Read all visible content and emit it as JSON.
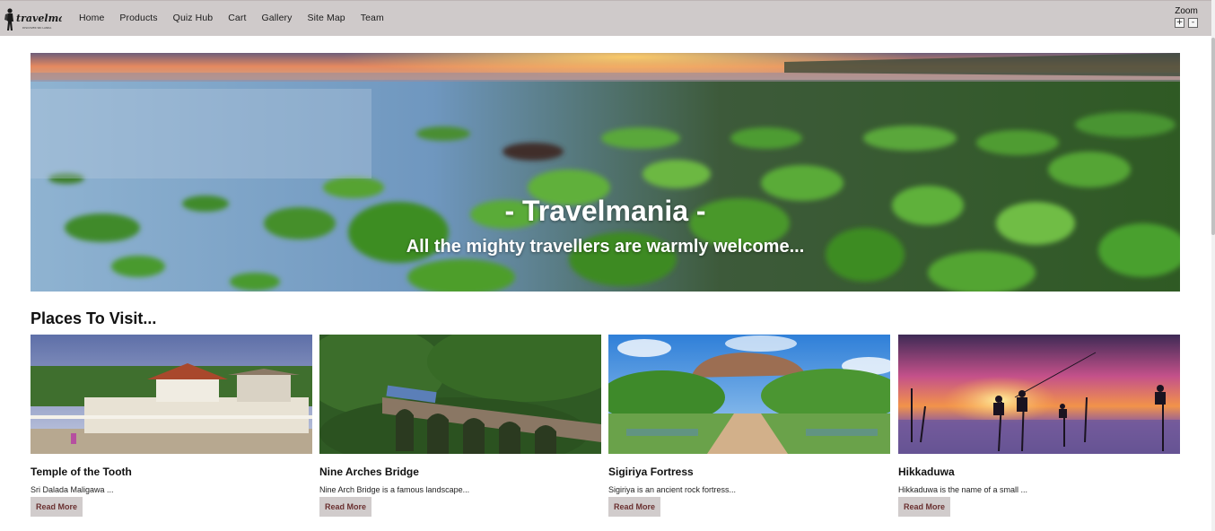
{
  "brand": {
    "logo_text": "Travelmania",
    "logo_tagline": "DISCOVER SRI LANKA"
  },
  "nav": {
    "links": [
      "Home",
      "Products",
      "Quiz Hub",
      "Cart",
      "Gallery",
      "Site Map",
      "Team"
    ]
  },
  "zoom": {
    "label": "Zoom",
    "plus": "+",
    "minus": "-"
  },
  "hero": {
    "title": "- Travelmania -",
    "subtitle": "All the mighty travellers are warmly welcome..."
  },
  "places": {
    "heading": "Places To Visit...",
    "read_more_label": "Read More",
    "items": [
      {
        "title": "Temple of the Tooth",
        "desc": "Sri Dalada Maligawa ..."
      },
      {
        "title": "Nine Arches Bridge",
        "desc": "Nine Arch Bridge is a famous landscape..."
      },
      {
        "title": "Sigiriya Fortress",
        "desc": "Sigiriya is an ancient rock fortress..."
      },
      {
        "title": "Hikkaduwa",
        "desc": "Hikkaduwa is the name of a small ..."
      }
    ]
  },
  "colors": {
    "navbar_bg": "#cfcaca",
    "button_bg": "#d1cccc",
    "button_text": "#6a3030"
  }
}
